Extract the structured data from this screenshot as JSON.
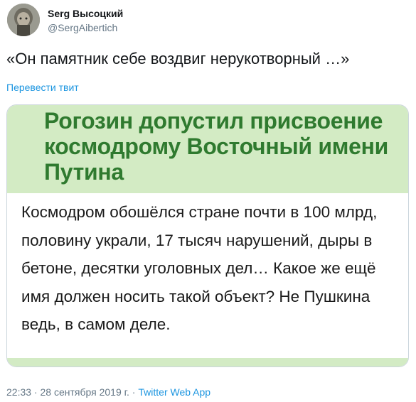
{
  "author": {
    "name": "Serg Высоцкий",
    "handle": "@SergAibertich"
  },
  "tweet": {
    "text": "«Он памятник себе воздвиг нерукотворный …»",
    "translate_label": "Перевести твит"
  },
  "media": {
    "headline": "Рогозин допустил присвоение космодрому Восточный имени Путина",
    "body": "Космодром обошёлся стране почти в 100 млрд, половину украли, 17 тысяч нарушений, дыры в бетоне, десятки уголовных дел… Какое же ещё имя должен носить такой объект? Не Пушкина ведь, в самом деле."
  },
  "meta": {
    "time": "22:33",
    "separator1": " · ",
    "date": "28 сентября 2019 г.",
    "separator2": " · ",
    "source": "Twitter Web App"
  },
  "colors": {
    "link": "#1b95e0",
    "headline_green": "#2f7a2f",
    "headline_bg": "#d3ebc4"
  }
}
